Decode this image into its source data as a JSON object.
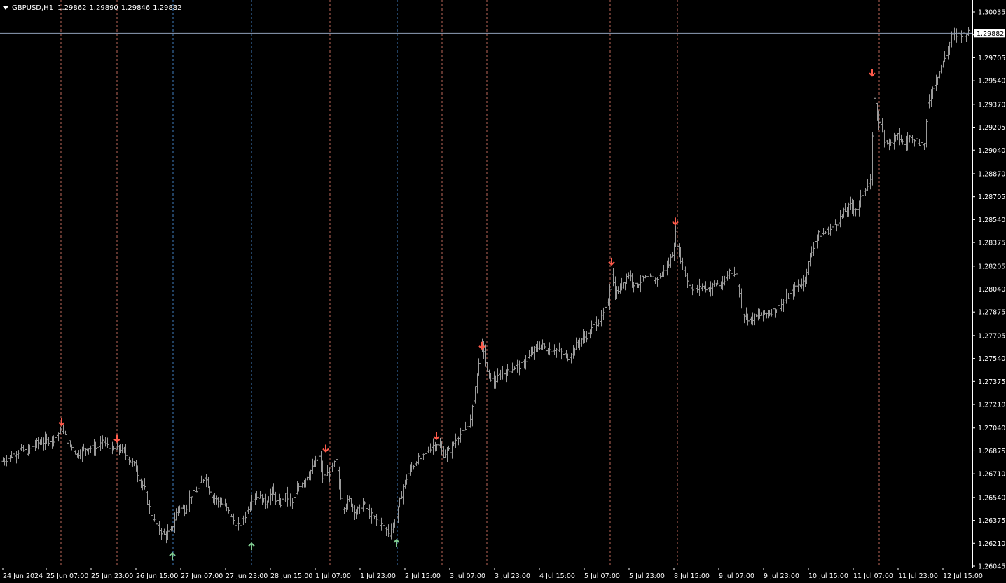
{
  "window": {
    "symbol": "GBPUSD,H1",
    "open": "1.29862",
    "high": "1.29890",
    "low": "1.29846",
    "close": "1.29882"
  },
  "colors": {
    "background": "#000000",
    "candles": "#9a9a9a",
    "down_marker": "#ff5a4a",
    "up_marker": "#7fc98f",
    "red_line": "#e07a6a",
    "blue_line": "#4a8fd8",
    "bid_line": "#8f9fb8"
  },
  "chart_data": {
    "type": "bar",
    "symbol": "GBPUSD",
    "timeframe": "H1",
    "current_price": "1.29882",
    "y_ticks": [
      "1.30035",
      "1.29870",
      "1.29705",
      "1.29540",
      "1.29370",
      "1.29205",
      "1.29040",
      "1.28870",
      "1.28705",
      "1.28540",
      "1.28375",
      "1.28205",
      "1.28040",
      "1.27875",
      "1.27705",
      "1.27540",
      "1.27375",
      "1.27210",
      "1.27040",
      "1.26875",
      "1.26710",
      "1.26540",
      "1.26375",
      "1.26210",
      "1.26045"
    ],
    "x_ticks": [
      "24 Jun 2024",
      "25 Jun 07:00",
      "25 Jun 23:00",
      "26 Jun 15:00",
      "27 Jun 07:00",
      "27 Jun 23:00",
      "28 Jun 15:00",
      "1 Jul 07:00",
      "1 Jul 23:00",
      "2 Jul 15:00",
      "3 Jul 07:00",
      "3 Jul 23:00",
      "4 Jul 15:00",
      "5 Jul 07:00",
      "5 Jul 23:00",
      "8 Jul 15:00",
      "9 Jul 07:00",
      "9 Jul 23:00",
      "10 Jul 15:00",
      "11 Jul 07:00",
      "11 Jul 23:00",
      "12 Jul 15:00"
    ],
    "close_path": [
      [
        0,
        1.268
      ],
      [
        6,
        1.2685
      ],
      [
        10,
        1.2688
      ],
      [
        14,
        1.2687
      ],
      [
        20,
        1.2693
      ],
      [
        24,
        1.2694
      ],
      [
        30,
        1.2696
      ],
      [
        35,
        1.2703
      ],
      [
        38,
        1.2695
      ],
      [
        44,
        1.2685
      ],
      [
        50,
        1.269
      ],
      [
        55,
        1.2689
      ],
      [
        60,
        1.2694
      ],
      [
        64,
        1.2688
      ],
      [
        70,
        1.2689
      ],
      [
        78,
        1.2677
      ],
      [
        84,
        1.266
      ],
      [
        88,
        1.2642
      ],
      [
        92,
        1.2632
      ],
      [
        96,
        1.2627
      ],
      [
        100,
        1.263
      ],
      [
        104,
        1.2647
      ],
      [
        108,
        1.2645
      ],
      [
        112,
        1.2656
      ],
      [
        116,
        1.266
      ],
      [
        120,
        1.267
      ],
      [
        124,
        1.2656
      ],
      [
        128,
        1.2651
      ],
      [
        132,
        1.2648
      ],
      [
        136,
        1.2639
      ],
      [
        140,
        1.2633
      ],
      [
        144,
        1.2641
      ],
      [
        148,
        1.2653
      ],
      [
        152,
        1.2655
      ],
      [
        156,
        1.265
      ],
      [
        160,
        1.2658
      ],
      [
        164,
        1.2648
      ],
      [
        168,
        1.2655
      ],
      [
        172,
        1.265
      ],
      [
        176,
        1.2662
      ],
      [
        180,
        1.2668
      ],
      [
        184,
        1.2675
      ],
      [
        188,
        1.2683
      ],
      [
        190,
        1.2668
      ],
      [
        194,
        1.2672
      ],
      [
        198,
        1.268
      ],
      [
        202,
        1.2647
      ],
      [
        206,
        1.2652
      ],
      [
        210,
        1.2643
      ],
      [
        214,
        1.265
      ],
      [
        218,
        1.2642
      ],
      [
        222,
        1.2638
      ],
      [
        226,
        1.2633
      ],
      [
        230,
        1.2628
      ],
      [
        234,
        1.264
      ],
      [
        238,
        1.2662
      ],
      [
        242,
        1.2674
      ],
      [
        246,
        1.2681
      ],
      [
        250,
        1.2683
      ],
      [
        254,
        1.269
      ],
      [
        258,
        1.2693
      ],
      [
        262,
        1.2685
      ],
      [
        266,
        1.2688
      ],
      [
        270,
        1.2698
      ],
      [
        274,
        1.2701
      ],
      [
        278,
        1.2709
      ],
      [
        282,
        1.2742
      ],
      [
        284,
        1.2763
      ],
      [
        286,
        1.276
      ],
      [
        288,
        1.2743
      ],
      [
        292,
        1.2737
      ],
      [
        296,
        1.2743
      ],
      [
        300,
        1.2744
      ],
      [
        304,
        1.2748
      ],
      [
        308,
        1.2749
      ],
      [
        312,
        1.2754
      ],
      [
        316,
        1.276
      ],
      [
        320,
        1.2764
      ],
      [
        324,
        1.276
      ],
      [
        328,
        1.2761
      ],
      [
        332,
        1.2758
      ],
      [
        336,
        1.2755
      ],
      [
        340,
        1.2762
      ],
      [
        344,
        1.2768
      ],
      [
        348,
        1.2771
      ],
      [
        352,
        1.2779
      ],
      [
        356,
        1.2783
      ],
      [
        360,
        1.2795
      ],
      [
        362,
        1.2816
      ],
      [
        364,
        1.28
      ],
      [
        368,
        1.2807
      ],
      [
        372,
        1.2815
      ],
      [
        376,
        1.2806
      ],
      [
        380,
        1.2811
      ],
      [
        384,
        1.2812
      ],
      [
        388,
        1.2811
      ],
      [
        392,
        1.2815
      ],
      [
        396,
        1.2822
      ],
      [
        398,
        1.283
      ],
      [
        400,
        1.2844
      ],
      [
        402,
        1.283
      ],
      [
        404,
        1.2822
      ],
      [
        408,
        1.2807
      ],
      [
        412,
        1.2803
      ],
      [
        416,
        1.2806
      ],
      [
        420,
        1.2804
      ],
      [
        424,
        1.2808
      ],
      [
        428,
        1.2806
      ],
      [
        432,
        1.2817
      ],
      [
        436,
        1.2814
      ],
      [
        440,
        1.2787
      ],
      [
        444,
        1.2782
      ],
      [
        448,
        1.2784
      ],
      [
        452,
        1.2786
      ],
      [
        456,
        1.2787
      ],
      [
        460,
        1.279
      ],
      [
        464,
        1.2794
      ],
      [
        468,
        1.28
      ],
      [
        472,
        1.2806
      ],
      [
        476,
        1.2809
      ],
      [
        480,
        1.2827
      ],
      [
        484,
        1.2843
      ],
      [
        488,
        1.2844
      ],
      [
        492,
        1.2847
      ],
      [
        496,
        1.2852
      ],
      [
        500,
        1.2859
      ],
      [
        504,
        1.2864
      ],
      [
        508,
        1.2862
      ],
      [
        512,
        1.2876
      ],
      [
        516,
        1.2881
      ],
      [
        518,
        1.2943
      ],
      [
        520,
        1.293
      ],
      [
        524,
        1.2912
      ],
      [
        528,
        1.2909
      ],
      [
        532,
        1.2914
      ],
      [
        536,
        1.2908
      ],
      [
        540,
        1.2915
      ],
      [
        544,
        1.291
      ],
      [
        548,
        1.2908
      ],
      [
        550,
        1.2937
      ],
      [
        554,
        1.2952
      ],
      [
        558,
        1.2964
      ],
      [
        562,
        1.2976
      ],
      [
        564,
        1.2986
      ],
      [
        568,
        1.2987
      ],
      [
        572,
        1.29882
      ]
    ],
    "red_lines": [
      "25 Jun 07:00",
      "25 Jun 23:00",
      "1 Jul 07:00",
      "2 Jul 15:00",
      "3 Jul 07:00",
      "5 Jul 07:00",
      "8 Jul 15:00",
      "11 Jul 07:00"
    ],
    "blue_lines": [
      "26 Jun 15:00",
      "27 Jun 23:00",
      "1 Jul 23:00"
    ],
    "down_markers": [
      [
        35,
        1.27085
      ],
      [
        68,
        1.26965
      ],
      [
        192,
        1.26895
      ],
      [
        258,
        1.26985
      ],
      [
        285,
        1.27635
      ],
      [
        362,
        1.2824
      ],
      [
        400,
        1.2853
      ],
      [
        517,
        1.296
      ]
    ],
    "up_markers": [
      [
        101,
        1.26115
      ],
      [
        148,
        1.26185
      ],
      [
        234,
        1.2621
      ]
    ]
  }
}
